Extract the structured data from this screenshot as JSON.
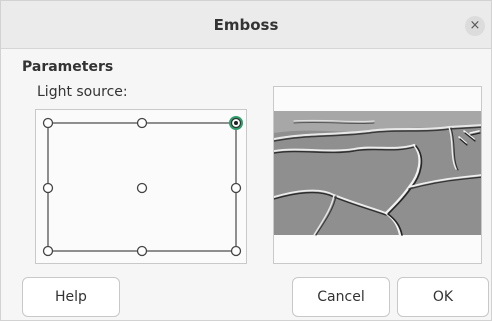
{
  "window": {
    "title": "Emboss",
    "close_glyph": "×"
  },
  "parameters": {
    "section_title": "Parameters",
    "light_source_label": "Light source:",
    "selected_light_position": "top-right",
    "light_positions": [
      "top-left",
      "top-center",
      "top-right",
      "middle-left",
      "center",
      "middle-right",
      "bottom-left",
      "bottom-center",
      "bottom-right"
    ]
  },
  "buttons": {
    "help": "Help",
    "cancel": "Cancel",
    "ok": "OK"
  },
  "colors": {
    "selected_point": "#2e9e6a",
    "point_stroke": "#444444"
  }
}
